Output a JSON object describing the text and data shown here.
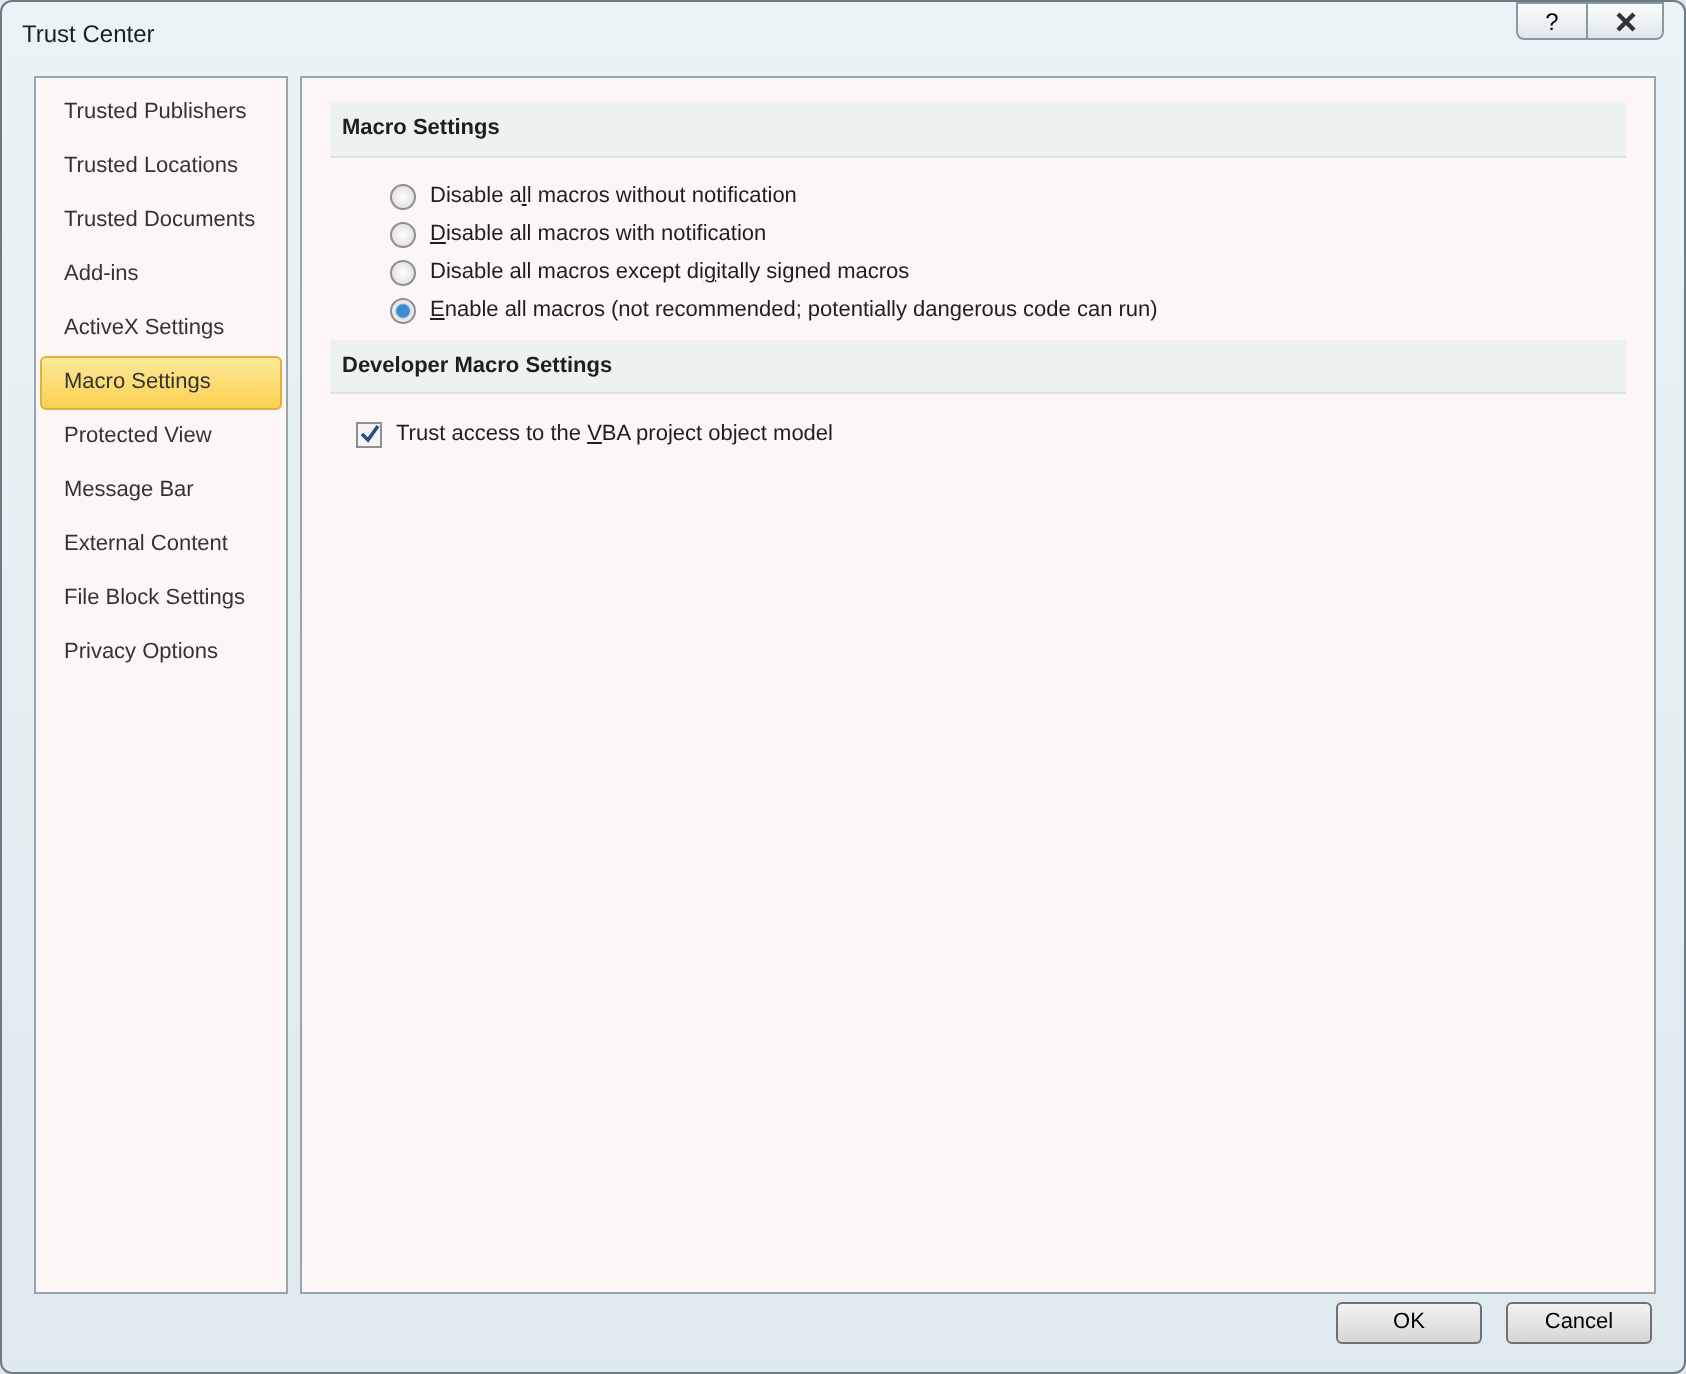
{
  "window": {
    "title": "Trust Center",
    "help_button": "?"
  },
  "sidebar": {
    "items": [
      {
        "label": "Trusted Publishers",
        "selected": false
      },
      {
        "label": "Trusted Locations",
        "selected": false
      },
      {
        "label": "Trusted Documents",
        "selected": false
      },
      {
        "label": "Add-ins",
        "selected": false
      },
      {
        "label": "ActiveX Settings",
        "selected": false
      },
      {
        "label": "Macro Settings",
        "selected": true
      },
      {
        "label": "Protected View",
        "selected": false
      },
      {
        "label": "Message Bar",
        "selected": false
      },
      {
        "label": "External Content",
        "selected": false
      },
      {
        "label": "File Block Settings",
        "selected": false
      },
      {
        "label": "Privacy Options",
        "selected": false
      }
    ]
  },
  "sections": [
    {
      "title": "Macro Settings",
      "options": [
        {
          "kind": "radio",
          "label": {
            "before": "Disable a",
            "key": "l",
            "after": "l macros without notification"
          },
          "selected": false
        },
        {
          "kind": "radio",
          "label": {
            "key": "D",
            "after": "isable all macros with notification"
          },
          "selected": false
        },
        {
          "kind": "radio",
          "label": {
            "before": "Disable all macros except di",
            "key": "g",
            "after": "itally signed macros"
          },
          "selected": false
        },
        {
          "kind": "radio",
          "label": {
            "key": "E",
            "after": "nable all macros (not recommended; potentially dangerous code can run)"
          },
          "selected": true
        }
      ]
    },
    {
      "title": "Developer Macro Settings",
      "options": [
        {
          "kind": "checkbox",
          "label": {
            "before": "Trust access to the ",
            "key": "V",
            "after": "BA project object model"
          },
          "checked": true
        }
      ]
    }
  ],
  "buttons": [
    "OK",
    "Cancel"
  ]
}
